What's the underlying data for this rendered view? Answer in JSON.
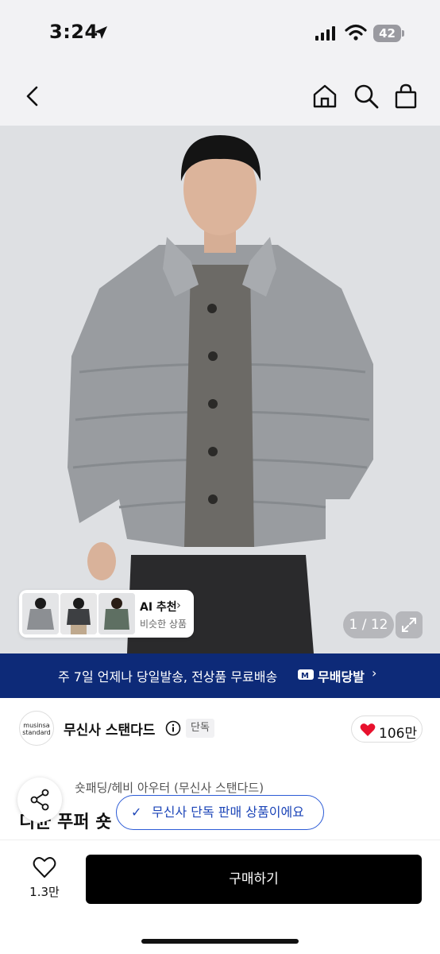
{
  "status_bar": {
    "time": "3:24",
    "battery": "42"
  },
  "header": {
    "icons": [
      "back-icon",
      "home-icon",
      "search-icon",
      "shopping-bag-icon"
    ]
  },
  "gallery": {
    "counter": "1 / 12",
    "ai_recommend": {
      "title": "AI 추천",
      "subtitle": "비슷한 상품"
    }
  },
  "promo": {
    "text": "주 7일 언제나 당일발송, 전상품 무료배송",
    "badge": "무배당발",
    "bg_color": "#0d2a78"
  },
  "brand": {
    "logo_line1": "musinsa",
    "logo_line2": "standard",
    "name": "무신사 스탠다드",
    "tag": "단독",
    "likes": "106만"
  },
  "product": {
    "category": "숏패딩/헤비 아우터 (무신사 스탠다드)",
    "title": "디균 푸퍼 숏",
    "title_tail": "]"
  },
  "toast": {
    "text": "무신사 단독 판매 상품이에요"
  },
  "bottom_bar": {
    "wish_count": "1.3만",
    "buy_label": "구매하기"
  }
}
